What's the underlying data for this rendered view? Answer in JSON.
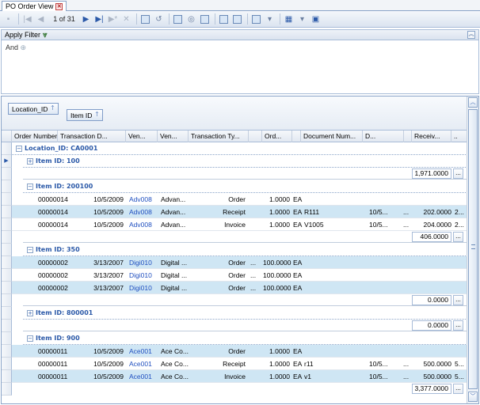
{
  "tab": {
    "title": "PO Order View",
    "close_icon": "close-icon"
  },
  "toolbar": {
    "pager": "1 of 31",
    "icons": [
      "save-icon",
      "first-page-icon",
      "prev-page-icon",
      "next-page-icon",
      "last-page-icon",
      "new-record-icon",
      "delete-icon",
      "print-icon",
      "refresh-icon",
      "print-preview-icon",
      "zoom-icon",
      "export-icon",
      "copy-icon",
      "paste-icon",
      "layout-icon",
      "chart-icon",
      "view-icon"
    ]
  },
  "filter": {
    "header": "Apply Filter",
    "condition": "And"
  },
  "grouping": {
    "chips": [
      "Location_ID",
      "Item ID"
    ]
  },
  "columns": [
    "Order Number",
    "Transaction D...",
    "Ven...",
    "Ven...",
    "Transaction Ty...",
    "",
    "Ord...",
    "",
    "Document Num...",
    "D...",
    "",
    "Receiv...",
    ".."
  ],
  "groups": {
    "location": "Location_ID: CA0001",
    "item_100": "Item ID: 100",
    "item_200100": "Item ID: 200100",
    "item_350": "Item ID: 350",
    "item_800001": "Item ID: 800001",
    "item_900": "Item ID: 900"
  },
  "summaries": {
    "s100": "1,971.0000",
    "s200100": "406.0000",
    "s350": "0.0000",
    "s800001": "0.0000",
    "total": "3,377.0000",
    "more": "..."
  },
  "rows_200100": [
    {
      "order": "00000014",
      "date": "10/5/2009",
      "vid": "Adv008",
      "vname": "Advan...",
      "type": "Order",
      "qty": "1.0000",
      "uom": "EA",
      "doc": "",
      "d": "",
      "rec": "",
      "tail": ""
    },
    {
      "order": "00000014",
      "date": "10/5/2009",
      "vid": "Adv008",
      "vname": "Advan...",
      "type": "Receipt",
      "qty": "1.0000",
      "uom": "EA",
      "doc": "R111",
      "d": "10/5...",
      "rec": "202.0000",
      "tail": "2..."
    },
    {
      "order": "00000014",
      "date": "10/5/2009",
      "vid": "Adv008",
      "vname": "Advan...",
      "type": "Invoice",
      "qty": "1.0000",
      "uom": "EA",
      "doc": "V1005",
      "d": "10/5...",
      "rec": "204.0000",
      "tail": "2..."
    }
  ],
  "rows_350": [
    {
      "order": "00000002",
      "date": "3/13/2007",
      "vid": "Digi010",
      "vname": "Digital ...",
      "type": "Order",
      "qty": "100.0000",
      "uom": "EA"
    },
    {
      "order": "00000002",
      "date": "3/13/2007",
      "vid": "Digi010",
      "vname": "Digital ...",
      "type": "Order",
      "qty": "100.0000",
      "uom": "EA"
    },
    {
      "order": "00000002",
      "date": "3/13/2007",
      "vid": "Digi010",
      "vname": "Digital ...",
      "type": "Order",
      "qty": "100.0000",
      "uom": "EA"
    }
  ],
  "rows_900": [
    {
      "order": "00000011",
      "date": "10/5/2009",
      "vid": "Ace001",
      "vname": "Ace Co...",
      "type": "Order",
      "qty": "1.0000",
      "uom": "EA",
      "doc": "",
      "d": "",
      "rec": "",
      "tail": ""
    },
    {
      "order": "00000011",
      "date": "10/5/2009",
      "vid": "Ace001",
      "vname": "Ace Co...",
      "type": "Receipt",
      "qty": "1.0000",
      "uom": "EA",
      "doc": "r11",
      "d": "10/5...",
      "rec": "500.0000",
      "tail": "5..."
    },
    {
      "order": "00000011",
      "date": "10/5/2009",
      "vid": "Ace001",
      "vname": "Ace Co...",
      "type": "Invoice",
      "qty": "1.0000",
      "uom": "EA",
      "doc": "v1",
      "d": "10/5...",
      "rec": "500.0000",
      "tail": "5..."
    }
  ],
  "ellipsis": "...",
  "dots": "..."
}
